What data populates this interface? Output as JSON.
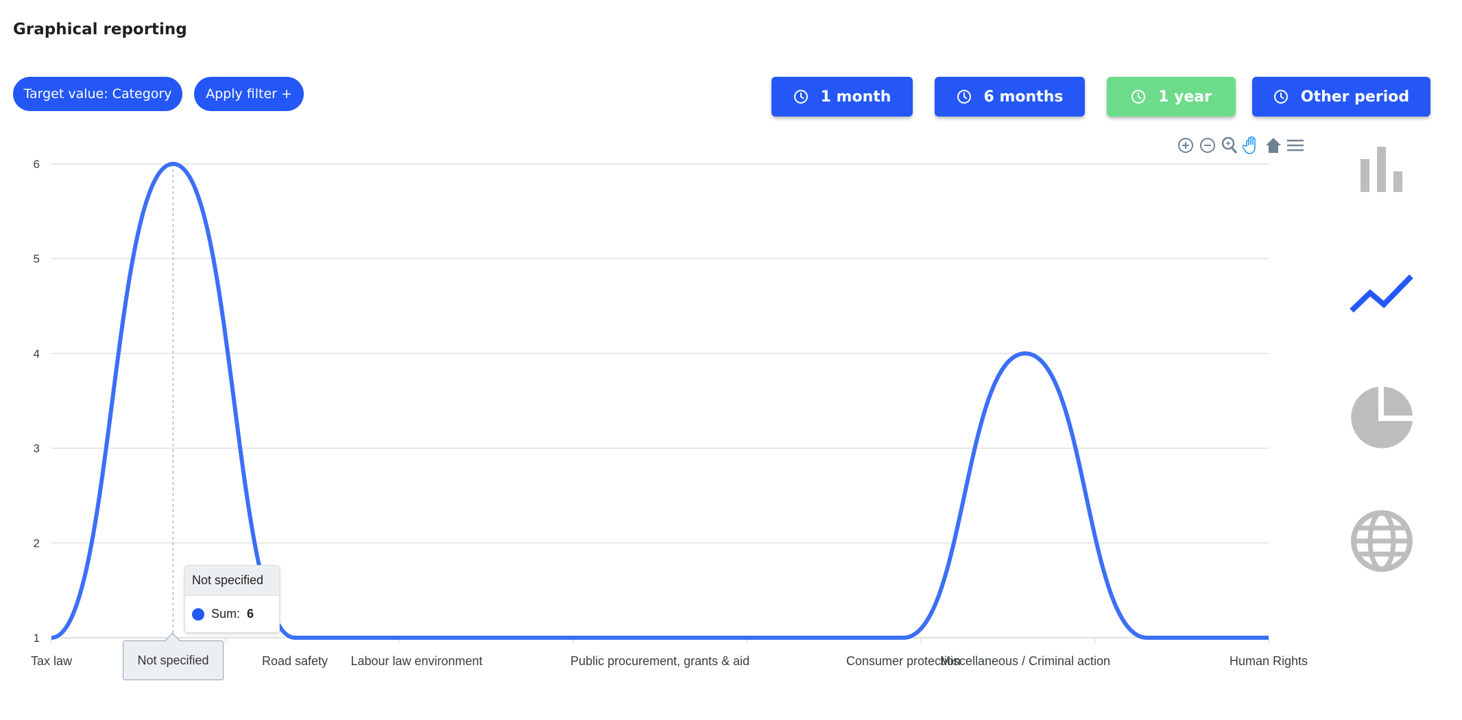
{
  "page": {
    "title": "Graphical reporting"
  },
  "filters": {
    "target_label": "Target value: Category",
    "apply_label": "Apply filter +"
  },
  "periods": [
    {
      "label": "1 month",
      "active": false
    },
    {
      "label": "6 months",
      "active": false
    },
    {
      "label": "1 year",
      "active": true
    },
    {
      "label": "Other period",
      "active": false
    }
  ],
  "colors": {
    "accent": "#2457f5",
    "active_period": "#6ddc8a",
    "line": "#3b6ff5",
    "inactive_icon": "#bdbdbd"
  },
  "toolbar": [
    "zoom-in-icon",
    "zoom-out-icon",
    "selection-zoom-icon",
    "pan-hand-icon",
    "reset-home-icon",
    "menu-icon"
  ],
  "chart_types": [
    {
      "icon": "bar-chart-icon",
      "active": false
    },
    {
      "icon": "line-chart-icon",
      "active": true
    },
    {
      "icon": "pie-chart-icon",
      "active": false
    },
    {
      "icon": "globe-map-icon",
      "active": false
    }
  ],
  "tooltip": {
    "title": "Not specified",
    "series_label": "Sum:",
    "value": "6",
    "x_label": "Not specified"
  },
  "chart_data": {
    "type": "line",
    "smooth": true,
    "categories": [
      "Tax law",
      "Not specified",
      "Road safety",
      "Labour law environment",
      "",
      "Public procurement, grants & aid",
      "",
      "Consumer protection",
      "Miscellaneous / Criminal action",
      "",
      "Human Rights"
    ],
    "series": [
      {
        "values": [
          1,
          6,
          1,
          1,
          1,
          1,
          1,
          1,
          4,
          1,
          1
        ]
      }
    ],
    "yticks": [
      "1",
      "2",
      "3",
      "4",
      "5",
      "6"
    ],
    "ylim": [
      1,
      6
    ],
    "grid": true
  }
}
